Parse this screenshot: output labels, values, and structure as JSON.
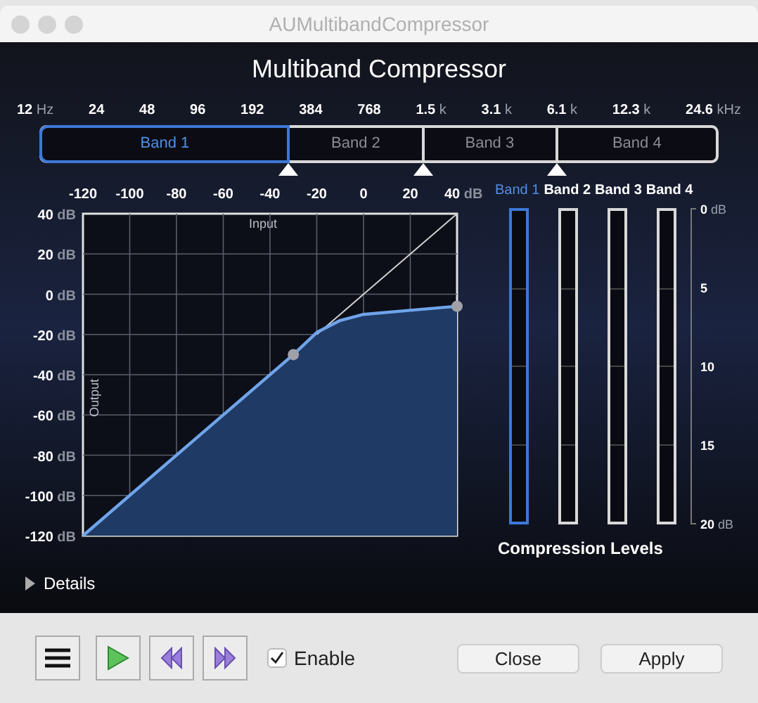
{
  "window": {
    "title": "AUMultibandCompressor"
  },
  "heading": "Multiband Compressor",
  "frequencies": [
    {
      "value": "12",
      "unit": "Hz"
    },
    {
      "value": "24"
    },
    {
      "value": "48"
    },
    {
      "value": "96"
    },
    {
      "value": "192"
    },
    {
      "value": "384"
    },
    {
      "value": "768"
    },
    {
      "value": "1.5",
      "unit": "k"
    },
    {
      "value": "3.1",
      "unit": "k"
    },
    {
      "value": "6.1",
      "unit": "k"
    },
    {
      "value": "12.3",
      "unit": "k"
    },
    {
      "value": "24.6",
      "unit": "kHz"
    }
  ],
  "bands": [
    {
      "label": "Band 1",
      "selected": true
    },
    {
      "label": "Band 2",
      "selected": false
    },
    {
      "label": "Band 3",
      "selected": false
    },
    {
      "label": "Band 4",
      "selected": false
    }
  ],
  "chart": {
    "chart_data": {
      "type": "line",
      "xlabel": "Input",
      "ylabel": "Output",
      "x": [
        -120,
        -30,
        -20,
        -10,
        0,
        20,
        40
      ],
      "grid": true,
      "series": [
        {
          "color": "#6fa4ea",
          "values": [
            -120,
            -30,
            -19,
            -13,
            -10,
            -8,
            -6
          ]
        },
        {
          "color": "#d0d0d0",
          "values": [
            null,
            null,
            -20,
            -10,
            0,
            20,
            40
          ]
        }
      ],
      "xlim": [
        -120,
        40
      ],
      "ylim": [
        -120,
        40
      ],
      "xticks": [
        -120,
        -100,
        -80,
        -60,
        -40,
        -20,
        0,
        20,
        {
          "value": 40,
          "label": "40 dB"
        }
      ],
      "yticks": [
        {
          "value": 40,
          "label": "40 dB"
        },
        {
          "value": 20,
          "label": "20 dB"
        },
        {
          "value": 0,
          "label": "0 dB"
        },
        {
          "value": -20,
          "label": "-20 dB"
        },
        {
          "value": -40,
          "label": "-40 dB"
        },
        {
          "value": -60,
          "label": "-60 dB"
        },
        {
          "value": -80,
          "label": "-80 dB"
        },
        {
          "value": -100,
          "label": "-100 dB"
        },
        {
          "value": -120,
          "label": "-120 dB"
        }
      ]
    }
  },
  "meters": {
    "bands": [
      {
        "label": "Band 1",
        "selected": true
      },
      {
        "label": "Band 2",
        "selected": false
      },
      {
        "label": "Band 3",
        "selected": false
      },
      {
        "label": "Band 4",
        "selected": false
      }
    ],
    "scale": [
      "0 dB",
      "5",
      "10",
      "15",
      "20 dB"
    ],
    "caption": "Compression Levels"
  },
  "details": {
    "label": "Details",
    "expanded": false
  },
  "toolbar": {
    "enable": {
      "label": "Enable",
      "checked": true
    },
    "buttons": [
      "Close",
      "Apply"
    ]
  }
}
